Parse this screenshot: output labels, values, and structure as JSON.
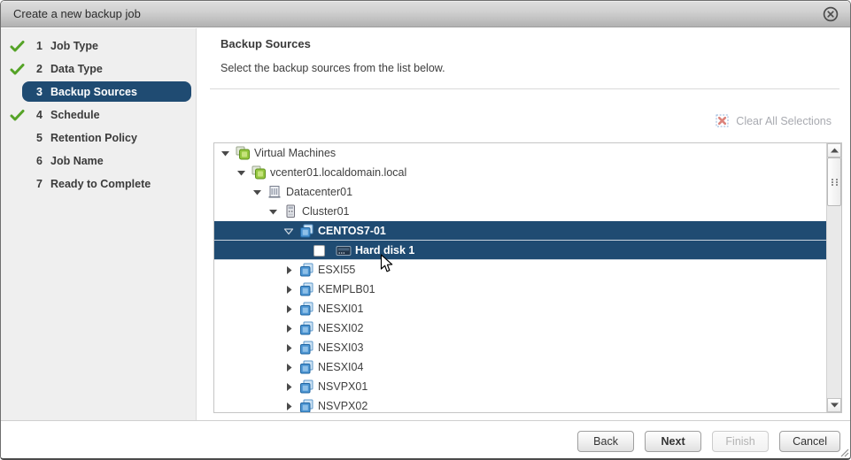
{
  "dialog": {
    "title": "Create a new backup job",
    "close_icon": "circle-x"
  },
  "wizard_steps": [
    {
      "num": "1",
      "label": "Job Type",
      "done": true,
      "active": false
    },
    {
      "num": "2",
      "label": "Data Type",
      "done": true,
      "active": false
    },
    {
      "num": "3",
      "label": "Backup Sources",
      "done": false,
      "active": true
    },
    {
      "num": "4",
      "label": "Schedule",
      "done": true,
      "active": false
    },
    {
      "num": "5",
      "label": "Retention Policy",
      "done": false,
      "active": false
    },
    {
      "num": "6",
      "label": "Job Name",
      "done": false,
      "active": false
    },
    {
      "num": "7",
      "label": "Ready to Complete",
      "done": false,
      "active": false
    }
  ],
  "content": {
    "heading": "Backup Sources",
    "subheading": "Select the backup sources from the list below.",
    "clear_all_label": "Clear All Selections",
    "clear_all_enabled": false
  },
  "tree": {
    "items": [
      {
        "label": "Virtual Machines",
        "level": 1,
        "icon": "vm-green",
        "expander": "expanded",
        "selected": false
      },
      {
        "label": "vcenter01.localdomain.local",
        "level": 2,
        "icon": "vm-green",
        "expander": "expanded",
        "selected": false
      },
      {
        "label": "Datacenter01",
        "level": 3,
        "icon": "datacenter",
        "expander": "expanded",
        "selected": false
      },
      {
        "label": "Cluster01",
        "level": 4,
        "icon": "cluster",
        "expander": "expanded",
        "selected": false
      },
      {
        "label": "CENTOS7-01",
        "level": 5,
        "icon": "vm-blue",
        "expander": "expanded",
        "selected": true
      },
      {
        "label": "Hard disk 1",
        "level": 6,
        "icon": "hard-disk",
        "expander": "none",
        "selected": true,
        "checkbox": "unchecked"
      },
      {
        "label": "ESXI55",
        "level": 5,
        "icon": "vm-blue",
        "expander": "collapsed",
        "selected": false
      },
      {
        "label": "KEMPLB01",
        "level": 5,
        "icon": "vm-blue",
        "expander": "collapsed",
        "selected": false
      },
      {
        "label": "NESXI01",
        "level": 5,
        "icon": "vm-blue",
        "expander": "collapsed",
        "selected": false
      },
      {
        "label": "NESXI02",
        "level": 5,
        "icon": "vm-blue",
        "expander": "collapsed",
        "selected": false
      },
      {
        "label": "NESXI03",
        "level": 5,
        "icon": "vm-blue",
        "expander": "collapsed",
        "selected": false
      },
      {
        "label": "NESXI04",
        "level": 5,
        "icon": "vm-blue",
        "expander": "collapsed",
        "selected": false
      },
      {
        "label": "NSVPX01",
        "level": 5,
        "icon": "vm-blue",
        "expander": "collapsed",
        "selected": false
      },
      {
        "label": "NSVPX02",
        "level": 5,
        "icon": "vm-blue",
        "expander": "collapsed",
        "selected": false
      }
    ],
    "scrollbar": {
      "orientation": "vertical",
      "thumb_position": "near-top"
    }
  },
  "footer": {
    "buttons": [
      {
        "label": "Back",
        "enabled": true,
        "primary": false
      },
      {
        "label": "Next",
        "enabled": true,
        "primary": true
      },
      {
        "label": "Finish",
        "enabled": false,
        "primary": false
      },
      {
        "label": "Cancel",
        "enabled": true,
        "primary": false
      }
    ]
  },
  "colors": {
    "selection_navy": "#1f4b72",
    "check_green": "#55a327",
    "titlebar_top": "#dedede",
    "titlebar_bottom": "#b2b2b2",
    "disabled_link": "#a8aab0",
    "clear_icon_red": "#dc837b",
    "clear_icon_border": "#92b3da"
  }
}
